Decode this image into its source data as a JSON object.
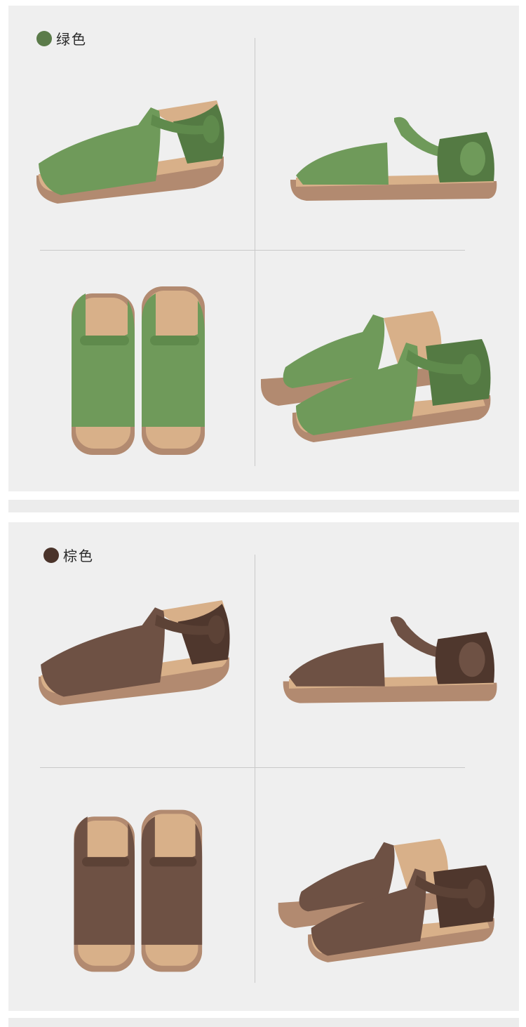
{
  "sections": [
    {
      "id": "green",
      "label": "绿色",
      "color": "#5b7b4a"
    },
    {
      "id": "brown",
      "label": "棕色",
      "color": "#4a332a"
    }
  ],
  "colors": {
    "green_leather": "#6f9a5a",
    "green_leather_dark": "#547a43",
    "brown_leather": "#6e5144",
    "brown_leather_dark": "#4f372d",
    "insole": "#d8b089",
    "sole": "#b28a70"
  }
}
